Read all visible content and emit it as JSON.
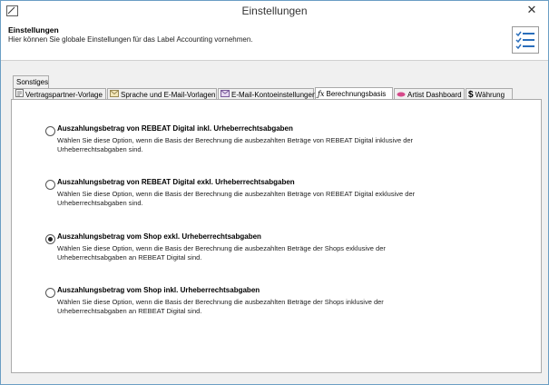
{
  "window": {
    "title": "Einstellungen",
    "close_glyph": "✕"
  },
  "header": {
    "title": "Einstellungen",
    "description": "Hier können Sie globale Einstellungen für das Label Accounting vornehmen.",
    "icon": "checklist-icon"
  },
  "tabs": {
    "row1": [
      {
        "label": "Sonstiges"
      }
    ],
    "row2": [
      {
        "label": "Vertragspartner-Vorlage",
        "icon": "contract-icon"
      },
      {
        "label": "Sprache und E-Mail-Vorlagen",
        "icon": "envelope-icon"
      },
      {
        "label": "E-Mail-Kontoeinstellungen",
        "icon": "mail-account-icon"
      },
      {
        "label": "Berechnungsbasis",
        "icon": "formula-icon",
        "selected": true
      },
      {
        "label": "Artist Dashboard",
        "icon": "dashboard-icon"
      },
      {
        "label": "Währung",
        "icon": "dollar-icon"
      }
    ]
  },
  "options": [
    {
      "label": "Auszahlungsbetrag von REBEAT Digital inkl. Urheberrechtsabgaben",
      "desc1": "Wählen Sie diese Option, wenn die Basis der Berechnung die ausbezahlten Beträge von REBEAT Digital inklusive der",
      "desc2": "Urheberrechtsabgaben sind.",
      "checked": false
    },
    {
      "label": "Auszahlungsbetrag von REBEAT Digital exkl. Urheberrechtsabgaben",
      "desc1": "Wählen Sie diese Option, wenn die Basis der Berechnung die ausbezahlten Beträge von REBEAT Digital exklusive der",
      "desc2": "Urheberrechtsabgaben sind.",
      "checked": false
    },
    {
      "label": "Auszahlungsbetrag vom Shop exkl. Urheberrechtsabgaben",
      "desc1": "Wählen Sie diese Option, wenn die Basis der Berechnung die ausbezahlten Beträge der Shops exklusive der",
      "desc2": "Urheberrechtsabgaben an REBEAT Digital sind.",
      "checked": true
    },
    {
      "label": "Auszahlungsbetrag vom Shop inkl. Urheberrechtsabgaben",
      "desc1": "Wählen Sie diese Option, wenn die Basis der Berechnung die ausbezahlten Beträge der Shops inklusive der",
      "desc2": "Urheberrechtsabgaben an REBEAT Digital sind.",
      "checked": false
    }
  ],
  "colors": {
    "window_border": "#6b9ec4",
    "selected_tab": "#ffffff"
  }
}
